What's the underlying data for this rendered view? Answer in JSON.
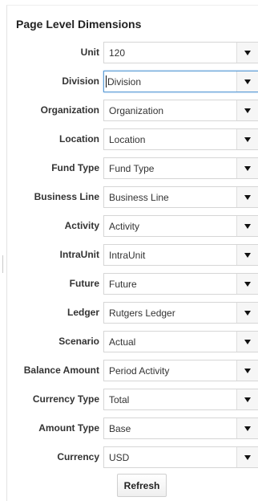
{
  "panel": {
    "title": "Page Level Dimensions"
  },
  "fields": [
    {
      "label": "Unit",
      "value": "120"
    },
    {
      "label": "Division",
      "value": "Division"
    },
    {
      "label": "Organization",
      "value": "Organization"
    },
    {
      "label": "Location",
      "value": "Location"
    },
    {
      "label": "Fund Type",
      "value": "Fund Type"
    },
    {
      "label": "Business Line",
      "value": "Business Line"
    },
    {
      "label": "Activity",
      "value": "Activity"
    },
    {
      "label": "IntraUnit",
      "value": "IntraUnit"
    },
    {
      "label": "Future",
      "value": "Future"
    },
    {
      "label": "Ledger",
      "value": "Rutgers Ledger"
    },
    {
      "label": "Scenario",
      "value": "Actual"
    },
    {
      "label": "Balance Amount",
      "value": "Period Activity"
    },
    {
      "label": "Currency Type",
      "value": "Total"
    },
    {
      "label": "Amount Type",
      "value": "Base"
    },
    {
      "label": "Currency",
      "value": "USD"
    }
  ],
  "focused_field": "Division",
  "icons": {
    "dropdown": "chevron-down-icon"
  },
  "actions": {
    "refresh_label": "Refresh"
  },
  "colors": {
    "focus_border": "#5a9bd5",
    "text": "#333333"
  }
}
